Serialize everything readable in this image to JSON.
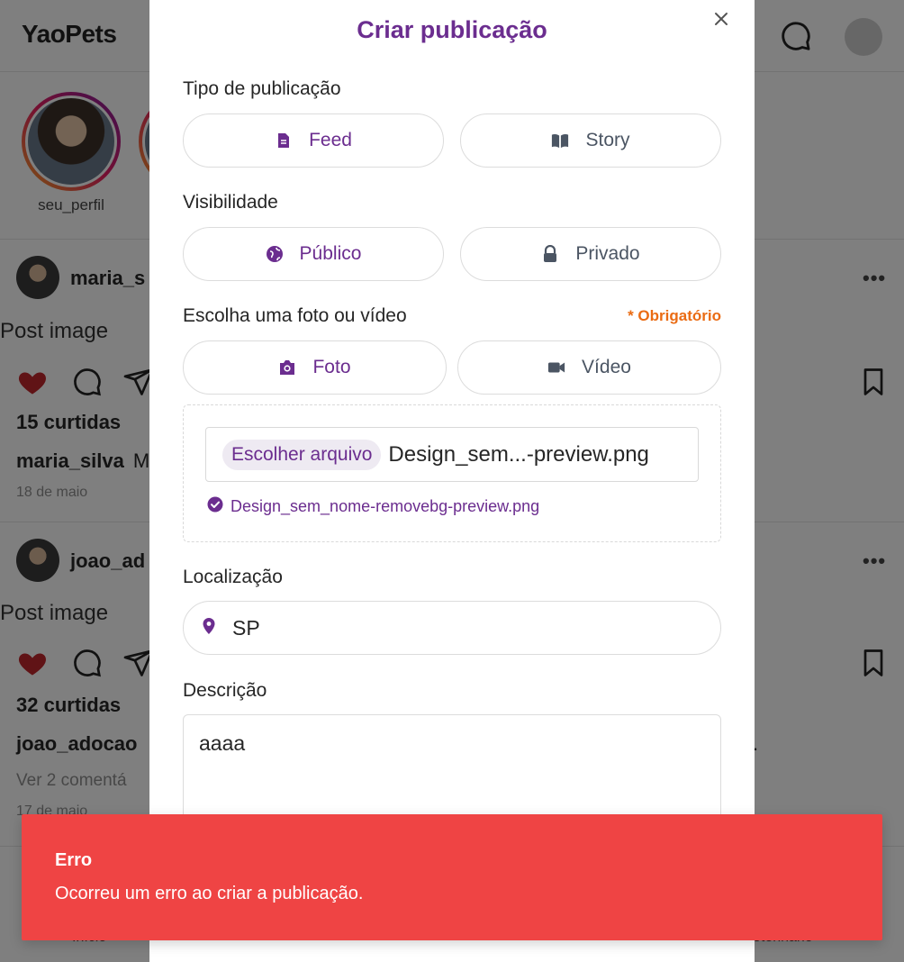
{
  "app": {
    "brand": "YaoPets",
    "stories": [
      {
        "label": "seu_perfil"
      }
    ],
    "posts": [
      {
        "user": "maria_s",
        "image_alt": "Post image",
        "likes": "15 curtidas",
        "caption_user": "maria_silva",
        "caption_text": "M",
        "comments": "",
        "date": "18 de maio",
        "more": "•••"
      },
      {
        "user": "joao_ad",
        "image_alt": "Post image",
        "likes": "32 curtidas",
        "caption_user": "joao_adocao",
        "caption_text": "",
        "caption_tail": ".",
        "comments": "Ver 2 comentá",
        "date": "17 de maio",
        "more": "•••"
      }
    ],
    "bottom_nav": {
      "left_label": "Início",
      "right_label": "eterinário"
    }
  },
  "modal": {
    "title": "Criar publicação",
    "type_section": {
      "label": "Tipo de publicação",
      "options": [
        {
          "label": "Feed",
          "icon": "document-icon",
          "selected": true
        },
        {
          "label": "Story",
          "icon": "book-icon",
          "selected": false
        }
      ]
    },
    "visibility_section": {
      "label": "Visibilidade",
      "options": [
        {
          "label": "Público",
          "icon": "globe-icon",
          "selected": true
        },
        {
          "label": "Privado",
          "icon": "lock-icon",
          "selected": false
        }
      ]
    },
    "media_section": {
      "label": "Escolha uma foto ou vídeo",
      "required": "* Obrigatório",
      "options": [
        {
          "label": "Foto",
          "icon": "camera-icon",
          "selected": true
        },
        {
          "label": "Vídeo",
          "icon": "video-camera-icon",
          "selected": false
        }
      ],
      "file_button": "Escolher arquivo",
      "file_display": "Design_sem...-preview.png",
      "file_confirmed": "Design_sem_nome-removebg-preview.png"
    },
    "location_section": {
      "label": "Localização",
      "value": "SP"
    },
    "description_section": {
      "label": "Descrição",
      "value": "aaaa"
    }
  },
  "toast": {
    "title": "Erro",
    "message": "Ocorreu um erro ao criar a publicação.",
    "color": "#ef4444"
  },
  "colors": {
    "accent": "#6b2d8f",
    "required": "#ea6b13",
    "error": "#ef4444"
  }
}
